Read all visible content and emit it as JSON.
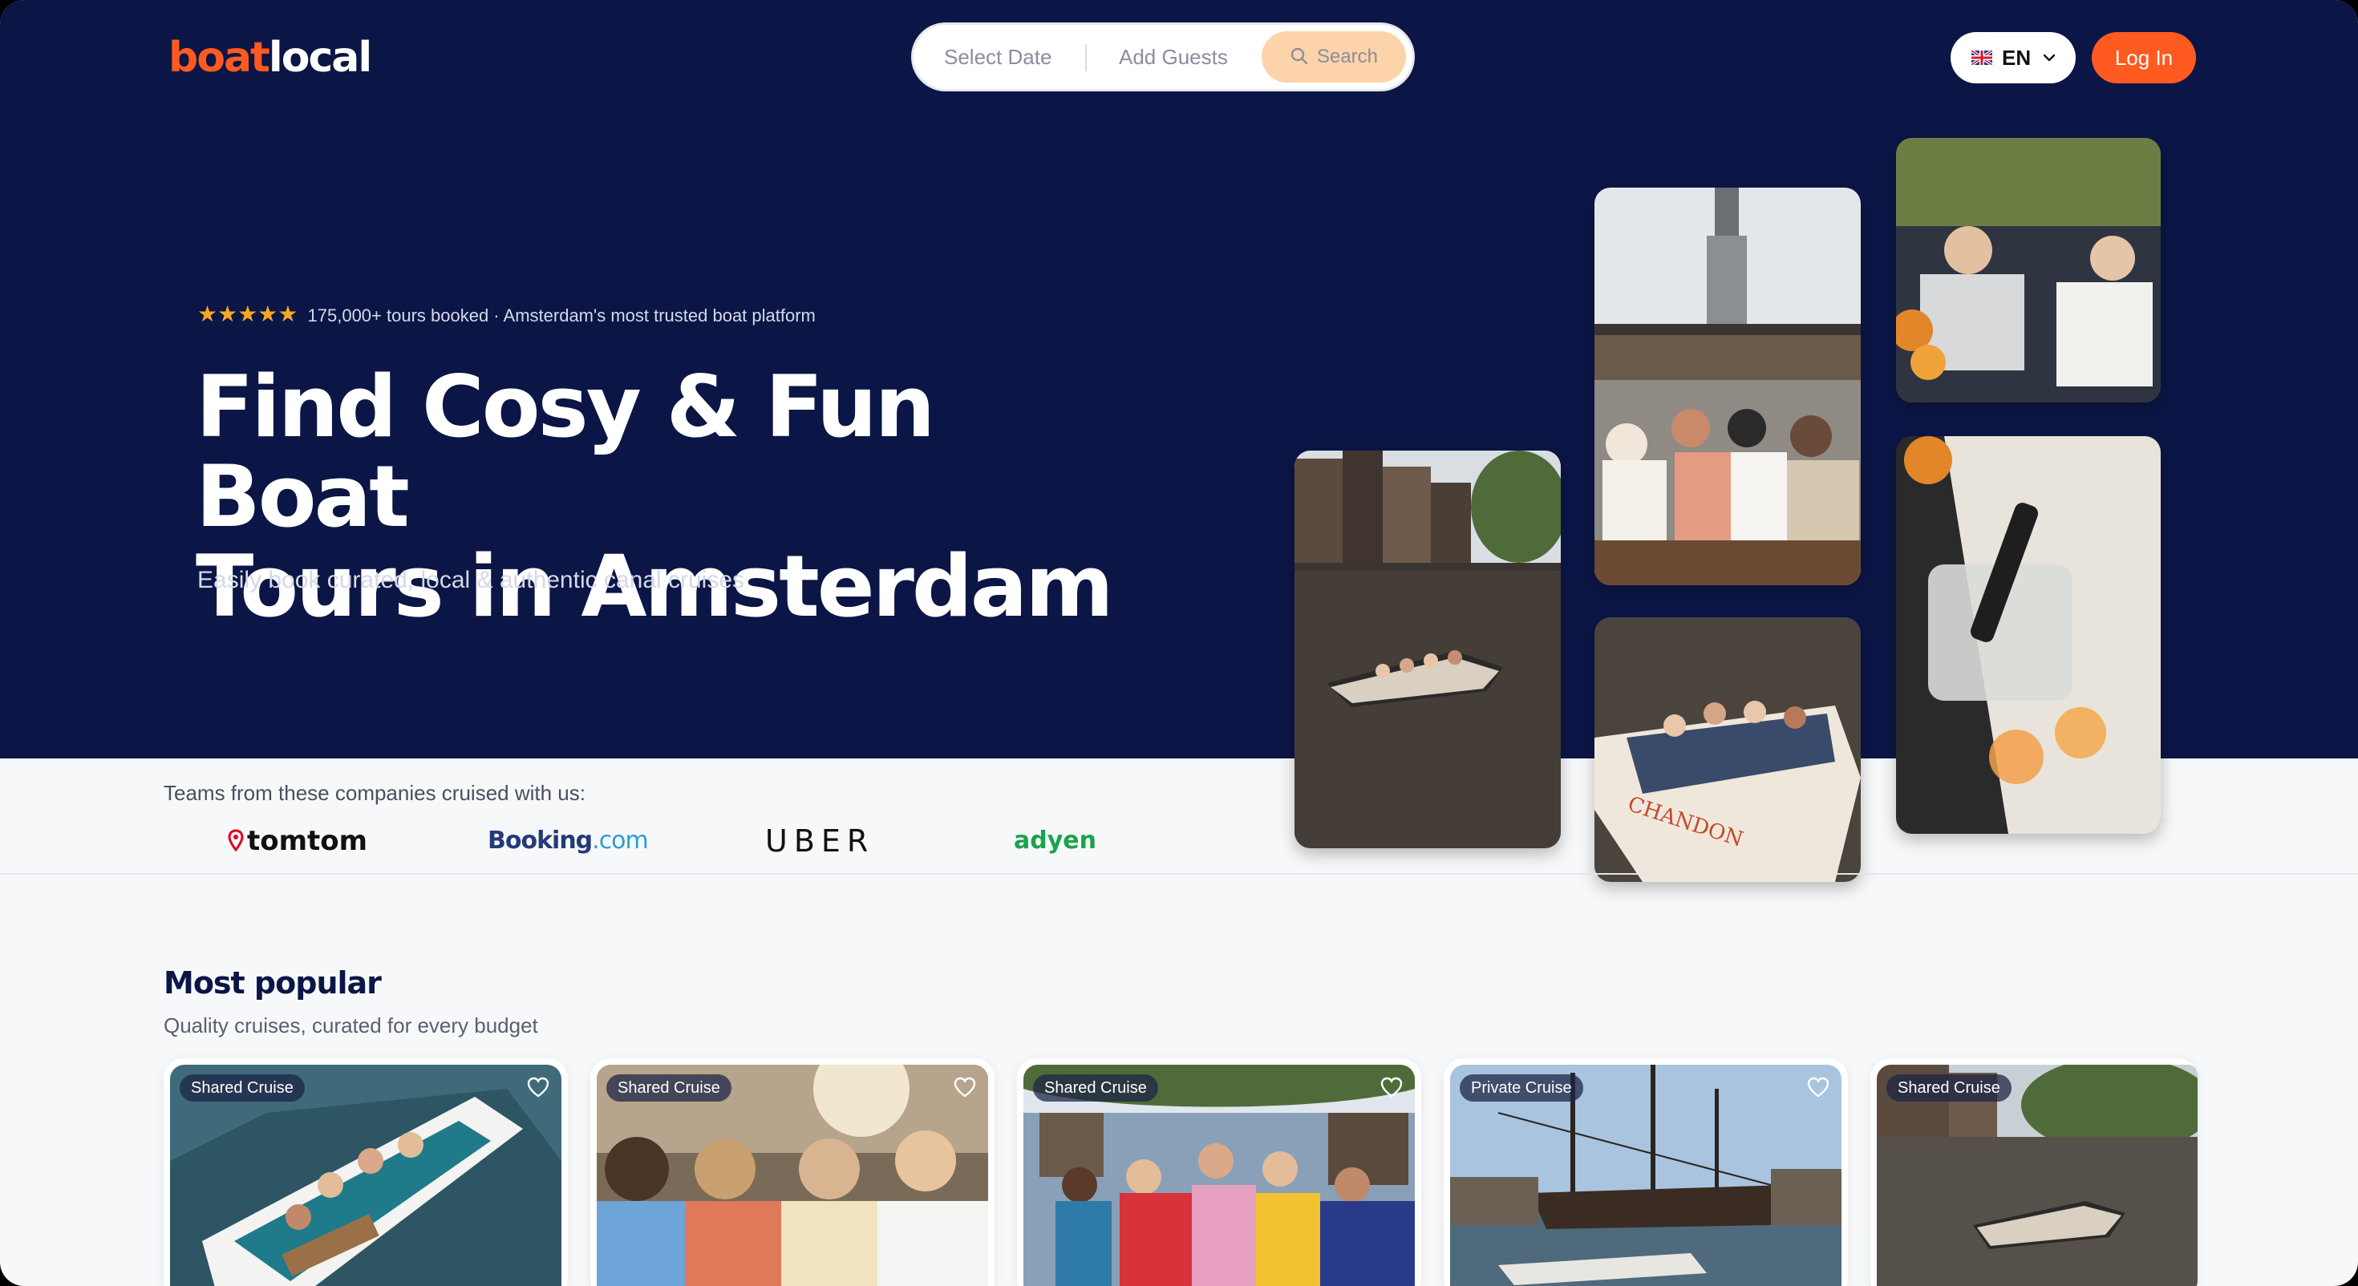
{
  "header": {
    "logo_part1": "boat",
    "logo_part2": "local",
    "search": {
      "date_placeholder": "Select Date",
      "guests_placeholder": "Add Guests",
      "button_label": "Search"
    },
    "language": "EN",
    "login_label": "Log In"
  },
  "hero": {
    "stars": "★★★★★",
    "rating_text": "175,000+ tours booked · Amsterdam's most trusted boat platform",
    "headline_line1": "Find Cosy & Fun Boat",
    "headline_line2": "Tours in Amsterdam",
    "subheadline": "Easily book curated, local & authentic canal cruises"
  },
  "partners": {
    "label": "Teams from these companies cruised with us:",
    "logos": [
      "tomtom",
      "Booking",
      ".com",
      "UBER",
      "adyen"
    ]
  },
  "most_popular": {
    "title": "Most popular",
    "subtitle": "Quality cruises, curated for every budget",
    "cards": [
      {
        "badge": "Shared Cruise"
      },
      {
        "badge": "Shared Cruise"
      },
      {
        "badge": "Shared Cruise"
      },
      {
        "badge": "Private Cruise"
      },
      {
        "badge": "Shared Cruise"
      }
    ]
  },
  "colors": {
    "hero_bg": "#0b1646",
    "brand_orange": "#ff5a1f",
    "search_button": "#fdd3aa"
  }
}
